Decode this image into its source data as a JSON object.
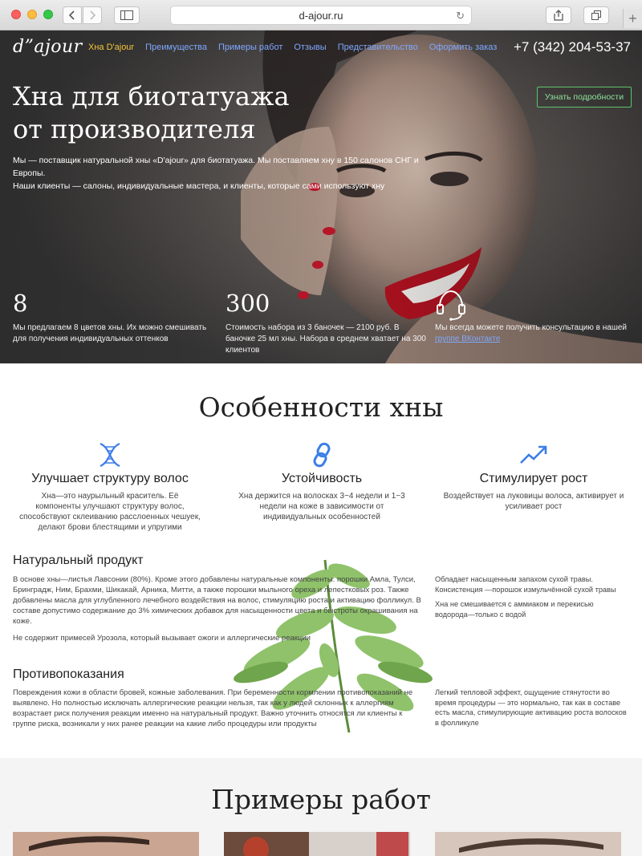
{
  "browser": {
    "url": "d-ajour.ru"
  },
  "header": {
    "logo": "d”ajour",
    "nav": [
      {
        "label": "Хна D'ajour",
        "active": true
      },
      {
        "label": "Преимущества"
      },
      {
        "label": "Примеры работ"
      },
      {
        "label": "Отзывы"
      },
      {
        "label": "Представительство"
      },
      {
        "label": "Оформить заказ"
      }
    ],
    "phone": "+7 (342) 204-53-37"
  },
  "hero": {
    "title_line1": "Хна для биотатуажа",
    "title_line2": "от производителя",
    "subtitle_line1": "Мы — поставщик натуральной хны «D'ajour» для биотатуажа. Мы поставляем хну в 150 салонов СНГ и Европы.",
    "subtitle_line2": "Наши клиенты — салоны, индивидуальные мастера, и клиенты, которые сами используют хну",
    "more_button": "Узнать подробности",
    "stats": [
      {
        "num": "8",
        "text": "Мы предлагаем 8 цветов хны. Их можно смешивать для получения индивидуальных оттенков"
      },
      {
        "num": "300",
        "text": "Стоимость набора из 3 баночек — 2100 руб. В баночке 25 мл хны. Набора в среднем хватает на 300 клиентов"
      },
      {
        "icon": "headset-icon",
        "text": "Мы всегда можете получить консультацию в нашей",
        "link": "группе ВКонтакте"
      }
    ],
    "colors": {
      "nav_link": "#7fa8ff",
      "nav_active": "#f2c43b",
      "button_border": "#5cc46b"
    }
  },
  "features": {
    "title": "Особенности хны",
    "items": [
      {
        "icon": "dna-icon",
        "title": "Улучшает структуру волос",
        "text": "Хна—это наурыльный краситель. Её компоненты улучшают структуру волос, способствуют склеиванию расслоенных чешуек, делают брови блестящими и упругими"
      },
      {
        "icon": "chain-link-icon",
        "title": "Устойчивость",
        "text": "Хна держится на волосках 3−4 недели и 1−3 недели на коже в зависимости от индивидуальных особенностей"
      },
      {
        "icon": "growth-chart-icon",
        "title": "Стимулирует рост",
        "text": "Воздействует на луковицы волоса, активирует и усиливает рост"
      }
    ],
    "natural": {
      "title": "Натуральный продукт",
      "p1": "В основе хны—листья Лавсонии (80%). Кроме этого добавлены натуральные компоненты: порошки Амла, Тулси, Бринградж, Ним, Брахми, Шикакай, Арника, Митти, а также порошки мыльного ореха и лепестковых роз. Также добавлены масла для углубленного лечебного воздействия на волос, стимуляцию роста и активацию фолликул. В составе допустимо содержание до 3% химических добавок для насыщенности цвета и быстроты окрашивания на коже.",
      "p2": "Не содержит примесей Урозола, который вызывает ожоги и аллергические реакции",
      "side1": "Обладает насыщенным запахом сухой травы. Консистенция —порошок измульчённой сухой травы",
      "side2": "Хна не смешивается с аммиаком и перекисью водорода—только с водой"
    },
    "contra": {
      "title": "Противопоказания",
      "p1": "Повреждения кожи в области бровей, кожные заболевания. При беременности кормлении противопоказаний не выявлено. Но полностью исключать аллергические реакции нельзя, так как у людей склонных к аллергиям возрастает риск получения реакции именно на натуральный продукт. Важно уточнить относятся ли клиенты к группе риска, возникали у них ранее реакции на какие либо процедуры или продукты",
      "side1": "Легкий тепловой эффект, ощущение стянутости во время процедуры — это нормально, так как в составе есть масла, стимулирующие активацию роста волосков в фолликуле"
    }
  },
  "works": {
    "title": "Примеры работ"
  }
}
